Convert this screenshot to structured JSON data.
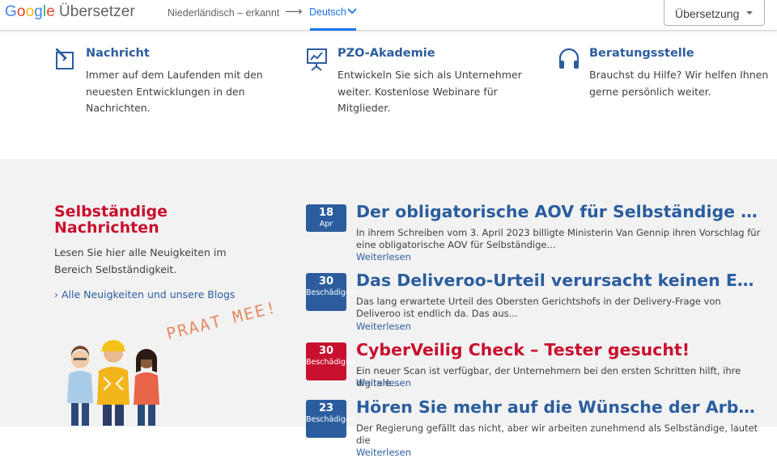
{
  "gt": {
    "logo_brand_letters": [
      "G",
      "o",
      "o",
      "g",
      "l",
      "e"
    ],
    "logo_product": "Übersetzer",
    "source_lang": "Niederländisch – erkannt",
    "arrow": "⟶",
    "target_lang": "Deutsch",
    "mode": "Übersetzung"
  },
  "features": [
    {
      "icon": "pencil-edit-icon",
      "title": "Nachricht",
      "desc": "Immer auf dem Laufenden mit den neuesten Entwicklungen in den Nachrichten."
    },
    {
      "icon": "presentation-board-icon",
      "title": "PZO-Akademie",
      "desc": "Entwickeln Sie sich als Unternehmer weiter. Kostenlose Webinare für Mitglieder."
    },
    {
      "icon": "headphones-icon",
      "title": "Beratungsstelle",
      "desc": "Brauchst du Hilfe? Wir helfen Ihnen gerne persönlich weiter."
    }
  ],
  "sidebar": {
    "title": "Selbständige Nachrichten",
    "desc": "Lesen Sie hier alle Neuigkeiten im Bereich Selbständigkeit.",
    "link": "› Alle Neuigkeiten und unsere Blogs",
    "praat": "PRAAT MEE!"
  },
  "articles": [
    {
      "day": "18",
      "month": "Apr",
      "title": "Der obligatorische AOV für Selbständige – wic",
      "text": "In ihrem Schreiben vom 3. April 2023 billigte Ministerin Van Gennip ihren Vorschlag für eine obligatorische AOV für Selbständige...",
      "more": "Weiterlesen"
    },
    {
      "day": "30",
      "month": "Beschädigen",
      "title": "Das Deliveroo-Urteil verursacht keinen Erdru",
      "text": "Das lang erwartete Urteil des Obersten Gerichtshofs in der Delivery-Frage von Deliveroo ist endlich da. Das aus...",
      "more": "Weiterlesen"
    },
    {
      "day": "30",
      "month": "Beschädigen",
      "title": "CyberVeilig Check – Tester gesucht!",
      "text": "Ein neuer Scan ist verfügbar, der Unternehmern bei den ersten Schritten hilft, ihre digitale...",
      "more": "Weiterlesen"
    },
    {
      "day": "23",
      "month": "Beschädigen",
      "title": "Hören Sie mehr auf die Wünsche der Arbeitne",
      "text": "Der Regierung gefällt das nicht, aber wir arbeiten zunehmend als Selbständige, lautet die",
      "more": "Weiterlesen"
    }
  ],
  "ellipsis": "...",
  "colors": {
    "brand_blue": "#2b5d9e",
    "brand_red": "#c8102e",
    "google_blue": "#1a73e8"
  }
}
